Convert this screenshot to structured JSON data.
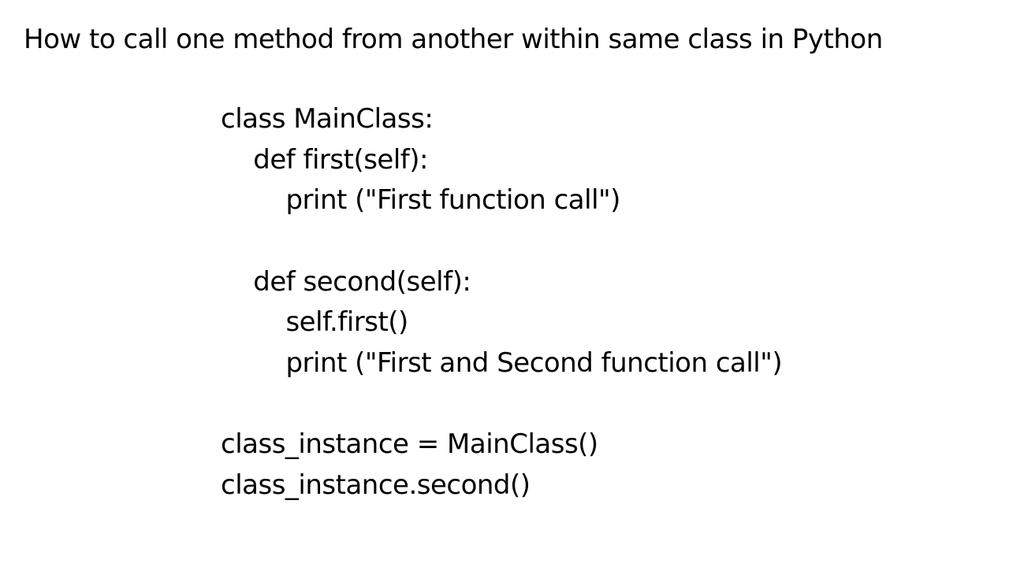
{
  "heading": "How to call one method from another within same class in Python",
  "code": "class MainClass:\n    def first(self):\n        print (\"First function call\")\n\n    def second(self):\n        self.first()\n        print (\"First and Second function call\")\n\nclass_instance = MainClass()\nclass_instance.second()"
}
